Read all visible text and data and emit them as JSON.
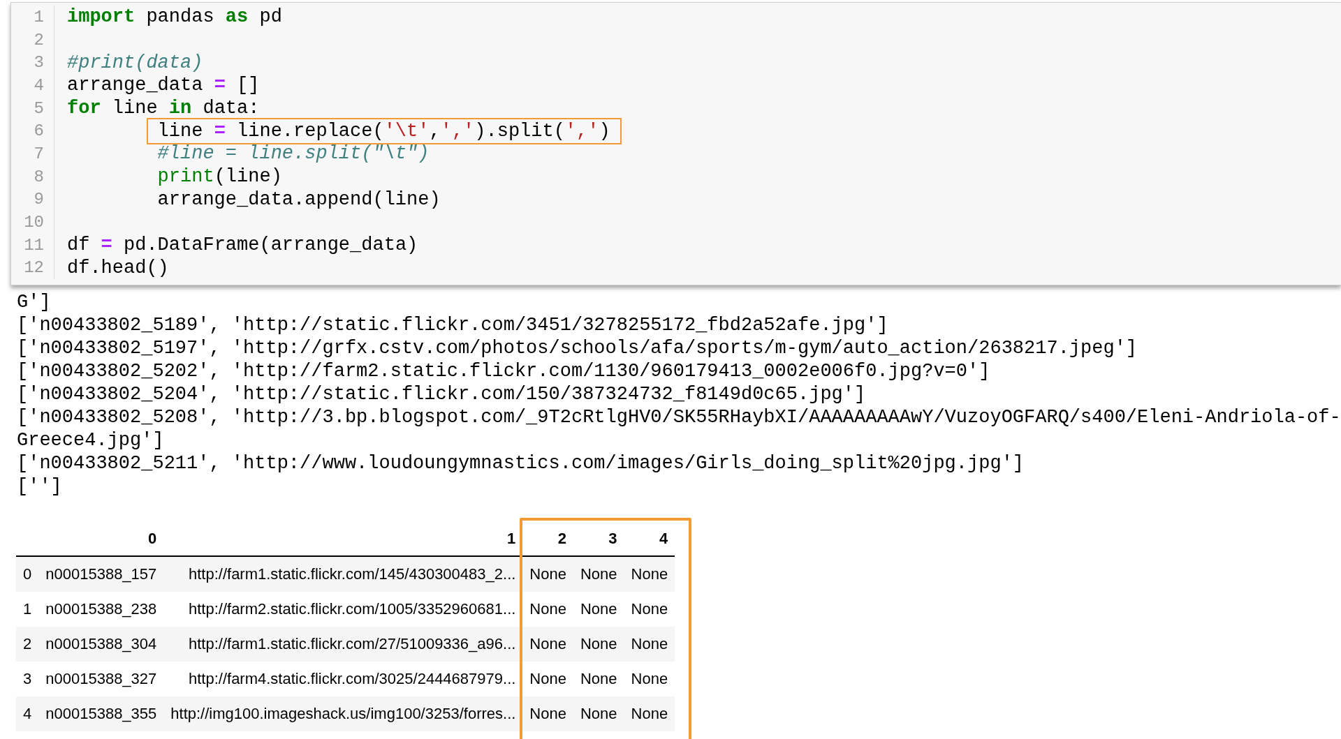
{
  "code_cell": {
    "lines": [
      {
        "number": "1",
        "indented": false,
        "highlighted": false,
        "tokens": [
          {
            "kind": "kw",
            "text": "import"
          },
          {
            "kind": "text",
            "text": " pandas "
          },
          {
            "kind": "kw",
            "text": "as"
          },
          {
            "kind": "text",
            "text": " pd"
          }
        ]
      },
      {
        "number": "2"
      },
      {
        "number": "3",
        "indented": false,
        "highlighted": false,
        "tokens": [
          {
            "kind": "comment",
            "text": "#print(data)"
          }
        ]
      },
      {
        "number": "4",
        "indented": false,
        "highlighted": false,
        "tokens": [
          {
            "kind": "text",
            "text": "arrange_data "
          },
          {
            "kind": "op",
            "text": "="
          },
          {
            "kind": "text",
            "text": " []"
          }
        ]
      },
      {
        "number": "5",
        "indented": false,
        "highlighted": false,
        "tokens": [
          {
            "kind": "kw",
            "text": "for"
          },
          {
            "kind": "text",
            "text": " line "
          },
          {
            "kind": "kw",
            "text": "in"
          },
          {
            "kind": "text",
            "text": " data:"
          }
        ]
      },
      {
        "number": "6",
        "indented": true,
        "highlighted": true,
        "tokens": [
          {
            "kind": "text",
            "text": "line "
          },
          {
            "kind": "op",
            "text": "="
          },
          {
            "kind": "text",
            "text": " line.replace("
          },
          {
            "kind": "str",
            "text": "'\\t'"
          },
          {
            "kind": "text",
            "text": ","
          },
          {
            "kind": "str",
            "text": "','"
          },
          {
            "kind": "text",
            "text": ").split("
          },
          {
            "kind": "str",
            "text": "','"
          },
          {
            "kind": "text",
            "text": ")"
          }
        ]
      },
      {
        "number": "7",
        "indented": true,
        "highlighted": false,
        "tokens": [
          {
            "kind": "comment",
            "text": "#line = line.split(\"\\t\")"
          }
        ]
      },
      {
        "number": "8",
        "indented": true,
        "highlighted": false,
        "tokens": [
          {
            "kind": "builtin",
            "text": "print"
          },
          {
            "kind": "text",
            "text": "(line)"
          }
        ]
      },
      {
        "number": "9",
        "indented": true,
        "highlighted": false,
        "tokens": [
          {
            "kind": "text",
            "text": "arrange_data.append(line)"
          }
        ]
      },
      {
        "number": "10"
      },
      {
        "number": "11",
        "indented": false,
        "highlighted": false,
        "tokens": [
          {
            "kind": "text",
            "text": "df "
          },
          {
            "kind": "op",
            "text": "="
          },
          {
            "kind": "text",
            "text": " pd.DataFrame(arrange_data)"
          }
        ]
      },
      {
        "number": "12",
        "indented": false,
        "highlighted": false,
        "tokens": [
          {
            "kind": "text",
            "text": "df.head()"
          }
        ]
      }
    ]
  },
  "output": {
    "lines": [
      "G']",
      "['n00433802_5189', 'http://static.flickr.com/3451/3278255172_fbd2a52afe.jpg']",
      "['n00433802_5197', 'http://grfx.cstv.com/photos/schools/afa/sports/m-gym/auto_action/2638217.jpeg']",
      "['n00433802_5202', 'http://farm2.static.flickr.com/1130/960179413_0002e006f0.jpg?v=0']",
      "['n00433802_5204', 'http://static.flickr.com/150/387324732_f8149d0c65.jpg']",
      "['n00433802_5208', 'http://3.bp.blogspot.com/_9T2cRtlgHV0/SK55RHaybXI/AAAAAAAAAwY/VuzoyOGFARQ/s400/Eleni-Andriola-of-",
      "Greece4.jpg']",
      "['n00433802_5211', 'http://www.loudoungymnastics.com/images/Girls_doing_split%20jpg.jpg']",
      "['']"
    ]
  },
  "table": {
    "columns": [
      {
        "label": "0",
        "highlighted": false
      },
      {
        "label": "1",
        "highlighted": false
      },
      {
        "label": "2",
        "highlighted": true
      },
      {
        "label": "3",
        "highlighted": true
      },
      {
        "label": "4",
        "highlighted": true
      }
    ],
    "rows": [
      {
        "index": "0",
        "cells": [
          "n00015388_157",
          "http://farm1.static.flickr.com/145/430300483_2...",
          "None",
          "None",
          "None"
        ]
      },
      {
        "index": "1",
        "cells": [
          "n00015388_238",
          "http://farm2.static.flickr.com/1005/3352960681...",
          "None",
          "None",
          "None"
        ]
      },
      {
        "index": "2",
        "cells": [
          "n00015388_304",
          "http://farm1.static.flickr.com/27/51009336_a96...",
          "None",
          "None",
          "None"
        ]
      },
      {
        "index": "3",
        "cells": [
          "n00015388_327",
          "http://farm4.static.flickr.com/3025/2444687979...",
          "None",
          "None",
          "None"
        ]
      },
      {
        "index": "4",
        "cells": [
          "n00015388_355",
          "http://img100.imageshack.us/img100/3253/forres...",
          "None",
          "None",
          "None"
        ]
      }
    ]
  }
}
